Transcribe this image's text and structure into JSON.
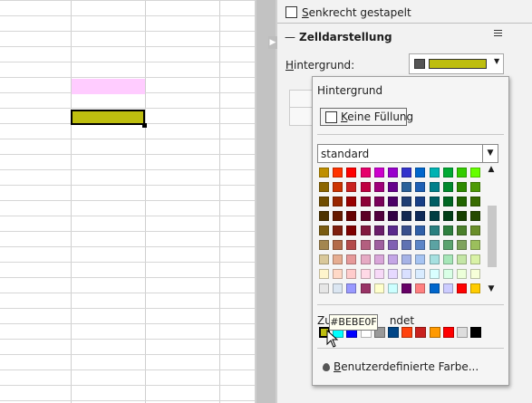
{
  "sidebar": {
    "stacked_label": "Senkrecht gestapelt",
    "section_title": "Zelldarstellung",
    "collapse_glyph": "—",
    "background_label": "Hintergrund:"
  },
  "popup": {
    "title": "Hintergrund",
    "no_fill_label": "Keine Füllung",
    "palette_value": "standard",
    "recent_label_pre": "Zu",
    "recent_label_post": "ndet",
    "tooltip": "#BEBE0F",
    "custom_color_label": "Benutzerdefinierte Farbe..."
  },
  "colors": {
    "selected_background": "#BEBE0F",
    "pink_cell": "#FFCCFF",
    "grid": [
      [
        "#bf8f00",
        "#ff3300",
        "#ff0000",
        "#e6006b",
        "#cc00cc",
        "#9900cc",
        "#3333cc",
        "#0066cc",
        "#00b3b3",
        "#00a933",
        "#33cc00",
        "#66ff00"
      ],
      [
        "#8c6600",
        "#cc3300",
        "#c9211e",
        "#bf0041",
        "#a0007a",
        "#66008c",
        "#2a6099",
        "#1e5fb4",
        "#00808b",
        "#008a2e",
        "#2e8b00",
        "#4e9a06"
      ],
      [
        "#704d00",
        "#992600",
        "#990000",
        "#8c0036",
        "#7a0059",
        "#4b0066",
        "#1f3d73",
        "#183f86",
        "#005d63",
        "#006623",
        "#216400",
        "#376b00"
      ],
      [
        "#4d3300",
        "#661a00",
        "#660000",
        "#5c0024",
        "#52003d",
        "#330044",
        "#142952",
        "#0f2a59",
        "#003d42",
        "#003d17",
        "#164000",
        "#254a00"
      ],
      [
        "#7a5c12",
        "#7f1f0f",
        "#7f0000",
        "#82193f",
        "#6b1f6b",
        "#5a2a8c",
        "#394f8c",
        "#3060a8",
        "#2a7f7f",
        "#2e7f3f",
        "#4a7f2a",
        "#6a8f2a"
      ],
      [
        "#a38650",
        "#b36b4a",
        "#b34a4a",
        "#b35f7f",
        "#9f5f9f",
        "#8060b3",
        "#6072b3",
        "#5c85c7",
        "#5ca3a3",
        "#5ca36f",
        "#7fa35c",
        "#9bbf5c"
      ],
      [
        "#d9c89a",
        "#e6ad91",
        "#e69999",
        "#e6aac4",
        "#d9a6d9",
        "#c4a6e6",
        "#a6b3e6",
        "#a6c4f2",
        "#a6e0e0",
        "#a6e6b8",
        "#c4e6a6",
        "#d9f2a6"
      ],
      [
        "#fff5cc",
        "#ffd9c7",
        "#ffcccc",
        "#ffd9e6",
        "#f7d9f7",
        "#e6d9ff",
        "#d9e0ff",
        "#d9ecff",
        "#d9ffff",
        "#d9ffe6",
        "#ecffd9",
        "#f7ffd9"
      ],
      [
        "#e6e6e6",
        "#dbe6f2",
        "#9999ff",
        "#993366",
        "#ffffcc",
        "#ccffff",
        "#660066",
        "#ff8080",
        "#0066cc",
        "#ccccff",
        "#ff0000",
        "#ffcc00"
      ]
    ],
    "recent": [
      "#BEBE0F",
      "#00FFFF",
      "#0000FF",
      "#FFFFFF",
      "#999999",
      "#004586",
      "#FF420E",
      "#C9211E",
      "#FF9900",
      "#FF0000",
      "#DDDDDD",
      "#000000"
    ]
  },
  "icons": {
    "dropdown": "chevron-down-icon",
    "scroll_up": "chevron-up-icon",
    "custom_color": "drop-icon",
    "menu": "hamburger-icon",
    "cursor": "mouse-pointer-icon"
  }
}
